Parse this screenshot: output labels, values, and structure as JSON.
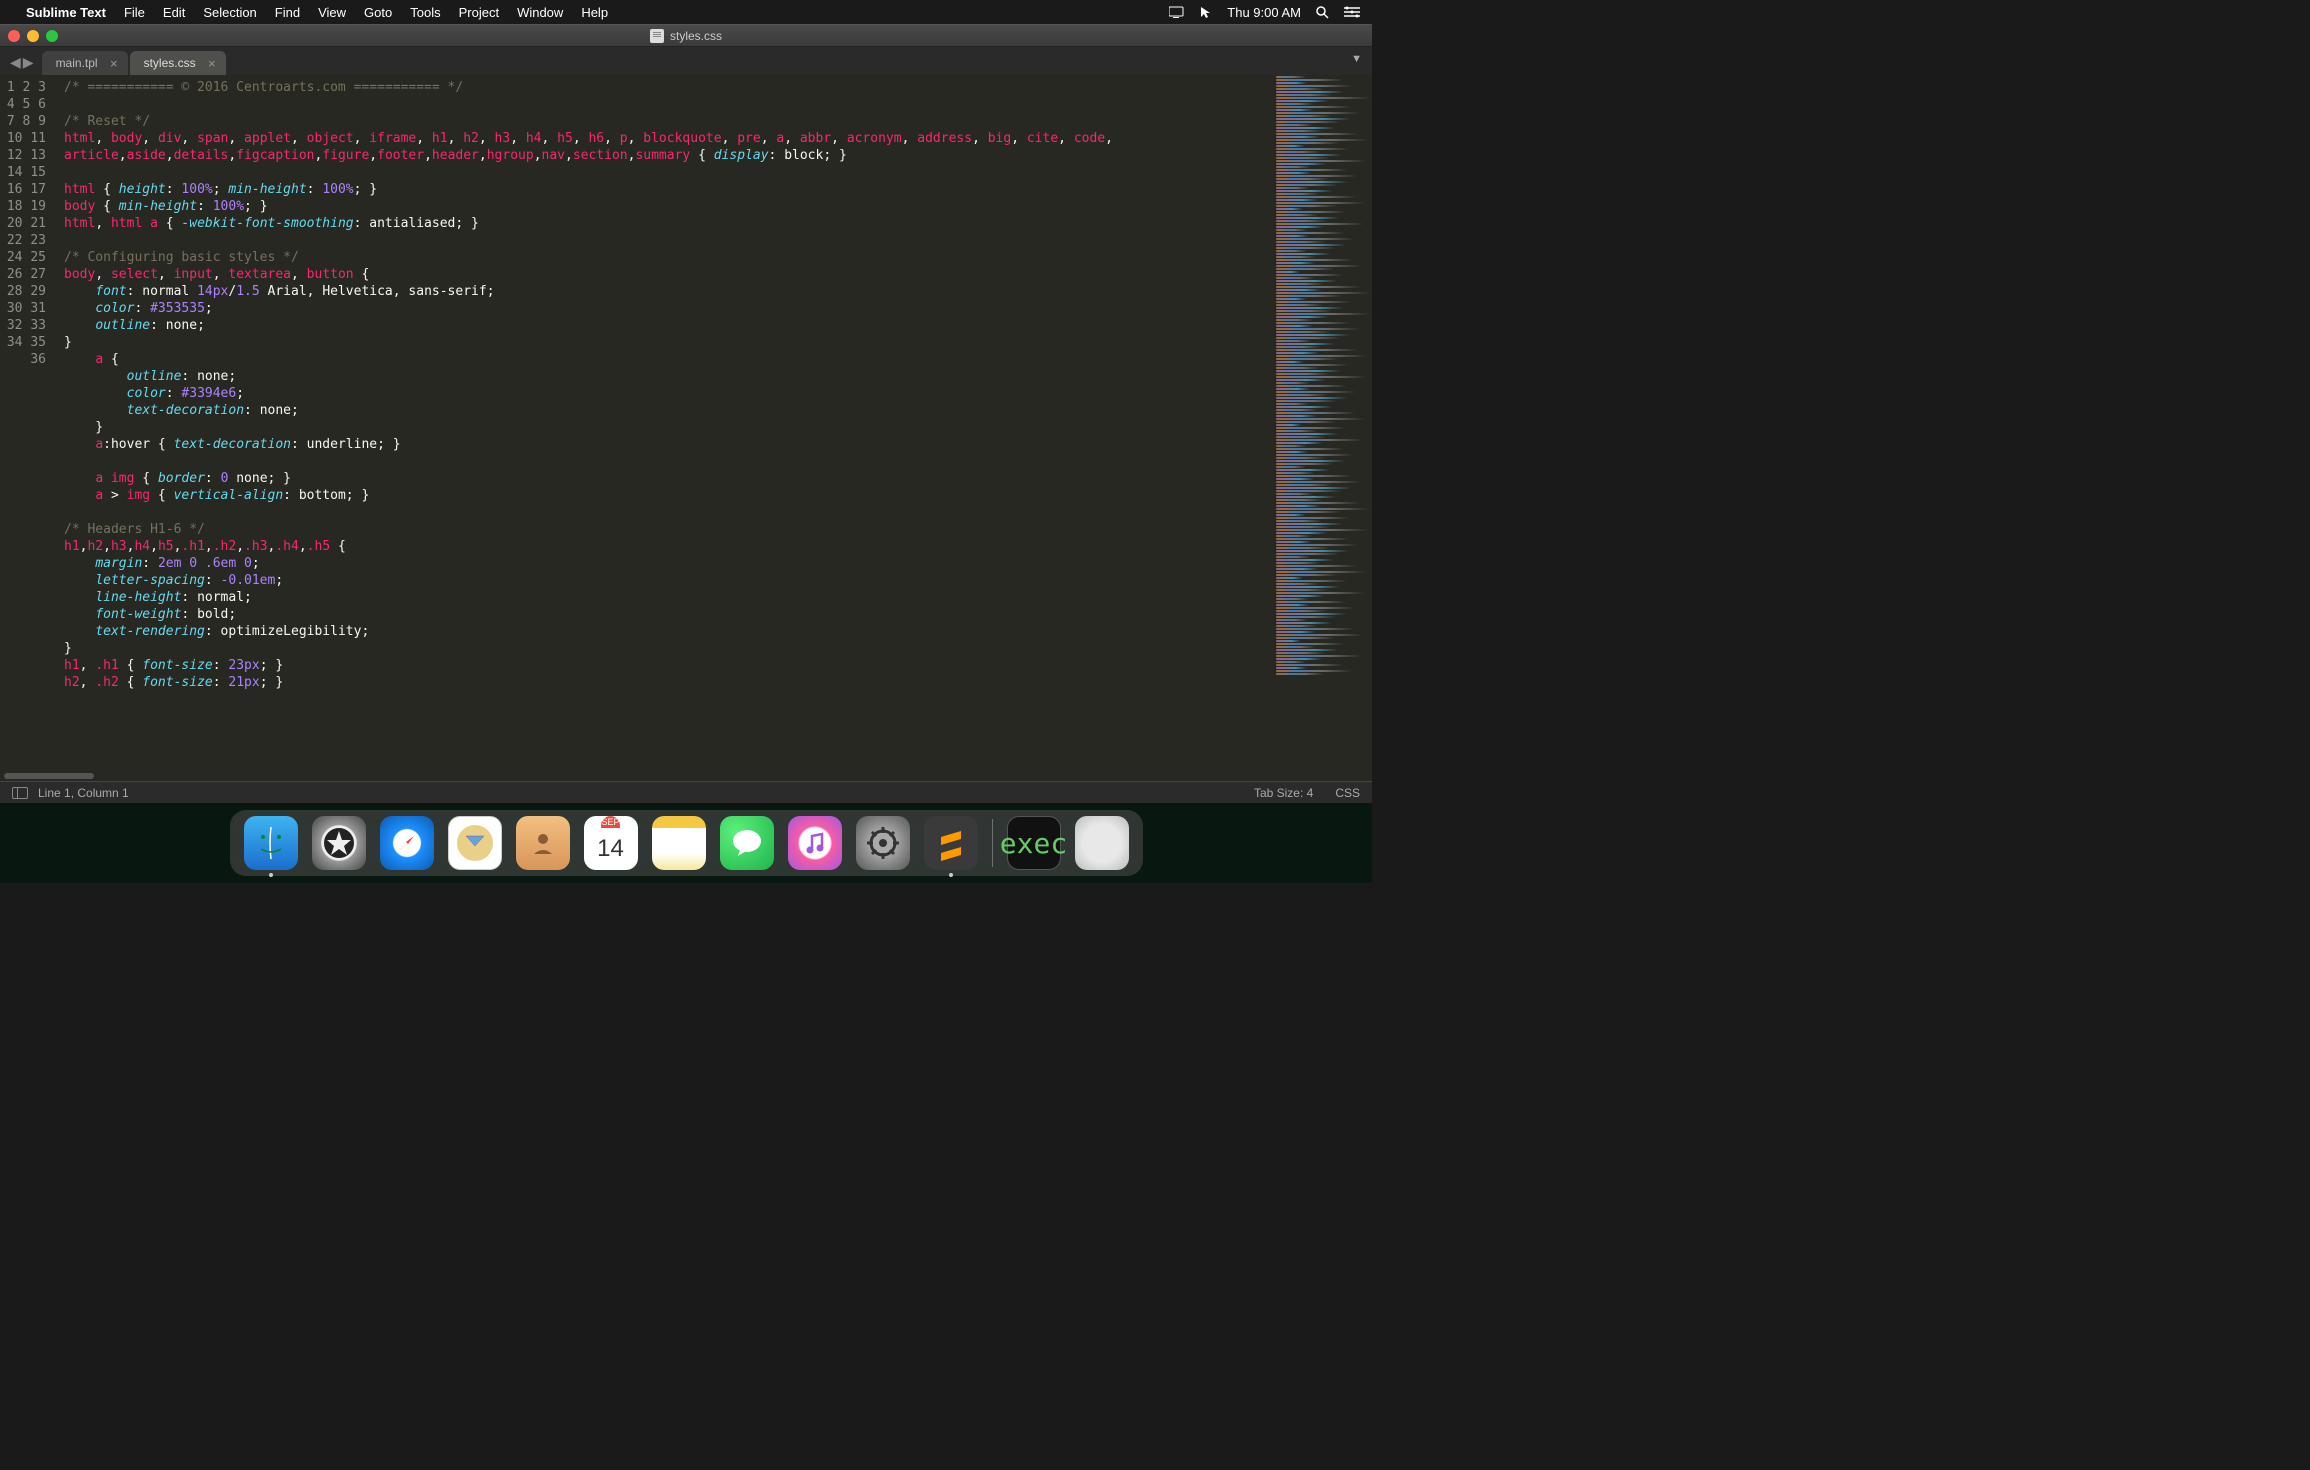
{
  "menubar": {
    "app_name": "Sublime Text",
    "items": [
      "File",
      "Edit",
      "Selection",
      "Find",
      "View",
      "Goto",
      "Tools",
      "Project",
      "Window",
      "Help"
    ],
    "right": {
      "time": "Thu 9:00 AM"
    }
  },
  "window": {
    "title": "styles.css"
  },
  "tabs": [
    {
      "label": "main.tpl",
      "active": false
    },
    {
      "label": "styles.css",
      "active": true
    }
  ],
  "gutter_start": 1,
  "gutter_end": 36,
  "code_lines": [
    [
      [
        "c-com",
        "/* =========== © 2016 Centroarts.com =========== */"
      ]
    ],
    [],
    [
      [
        "c-com",
        "/* Reset */"
      ]
    ],
    [
      [
        "c-tag",
        "html"
      ],
      [
        "c-punc",
        ", "
      ],
      [
        "c-tag",
        "body"
      ],
      [
        "c-punc",
        ", "
      ],
      [
        "c-tag",
        "div"
      ],
      [
        "c-punc",
        ", "
      ],
      [
        "c-tag",
        "span"
      ],
      [
        "c-punc",
        ", "
      ],
      [
        "c-tag",
        "applet"
      ],
      [
        "c-punc",
        ", "
      ],
      [
        "c-tag",
        "object"
      ],
      [
        "c-punc",
        ", "
      ],
      [
        "c-tag",
        "iframe"
      ],
      [
        "c-punc",
        ", "
      ],
      [
        "c-tag",
        "h1"
      ],
      [
        "c-punc",
        ", "
      ],
      [
        "c-tag",
        "h2"
      ],
      [
        "c-punc",
        ", "
      ],
      [
        "c-tag",
        "h3"
      ],
      [
        "c-punc",
        ", "
      ],
      [
        "c-tag",
        "h4"
      ],
      [
        "c-punc",
        ", "
      ],
      [
        "c-tag",
        "h5"
      ],
      [
        "c-punc",
        ", "
      ],
      [
        "c-tag",
        "h6"
      ],
      [
        "c-punc",
        ", "
      ],
      [
        "c-tag",
        "p"
      ],
      [
        "c-punc",
        ", "
      ],
      [
        "c-tag",
        "blockquote"
      ],
      [
        "c-punc",
        ", "
      ],
      [
        "c-tag",
        "pre"
      ],
      [
        "c-punc",
        ", "
      ],
      [
        "c-tag",
        "a"
      ],
      [
        "c-punc",
        ", "
      ],
      [
        "c-tag",
        "abbr"
      ],
      [
        "c-punc",
        ", "
      ],
      [
        "c-tag",
        "acronym"
      ],
      [
        "c-punc",
        ", "
      ],
      [
        "c-tag",
        "address"
      ],
      [
        "c-punc",
        ", "
      ],
      [
        "c-tag",
        "big"
      ],
      [
        "c-punc",
        ", "
      ],
      [
        "c-tag",
        "cite"
      ],
      [
        "c-punc",
        ", "
      ],
      [
        "c-tag",
        "code"
      ],
      [
        "c-punc",
        ", "
      ]
    ],
    [
      [
        "c-tag",
        "article"
      ],
      [
        "c-punc",
        ","
      ],
      [
        "c-tag",
        "aside"
      ],
      [
        "c-punc",
        ","
      ],
      [
        "c-tag",
        "details"
      ],
      [
        "c-punc",
        ","
      ],
      [
        "c-tag",
        "figcaption"
      ],
      [
        "c-punc",
        ","
      ],
      [
        "c-tag",
        "figure"
      ],
      [
        "c-punc",
        ","
      ],
      [
        "c-tag",
        "footer"
      ],
      [
        "c-punc",
        ","
      ],
      [
        "c-tag",
        "header"
      ],
      [
        "c-punc",
        ","
      ],
      [
        "c-tag",
        "hgroup"
      ],
      [
        "c-punc",
        ","
      ],
      [
        "c-tag",
        "nav"
      ],
      [
        "c-punc",
        ","
      ],
      [
        "c-tag",
        "section"
      ],
      [
        "c-punc",
        ","
      ],
      [
        "c-tag",
        "summary"
      ],
      [
        "c-punc",
        " { "
      ],
      [
        "c-prop",
        "display"
      ],
      [
        "c-punc",
        ": "
      ],
      [
        "c-val",
        "block"
      ],
      [
        "c-punc",
        "; }"
      ]
    ],
    [],
    [
      [
        "c-tag",
        "html"
      ],
      [
        "c-punc",
        " { "
      ],
      [
        "c-prop",
        "height"
      ],
      [
        "c-punc",
        ": "
      ],
      [
        "c-num",
        "100%"
      ],
      [
        "c-punc",
        "; "
      ],
      [
        "c-prop",
        "min-height"
      ],
      [
        "c-punc",
        ": "
      ],
      [
        "c-num",
        "100%"
      ],
      [
        "c-punc",
        "; }"
      ]
    ],
    [
      [
        "c-tag",
        "body"
      ],
      [
        "c-punc",
        " { "
      ],
      [
        "c-prop",
        "min-height"
      ],
      [
        "c-punc",
        ": "
      ],
      [
        "c-num",
        "100%"
      ],
      [
        "c-punc",
        "; }"
      ]
    ],
    [
      [
        "c-tag",
        "html"
      ],
      [
        "c-punc",
        ", "
      ],
      [
        "c-tag",
        "html a"
      ],
      [
        "c-punc",
        " { "
      ],
      [
        "c-prop",
        "-webkit-font-smoothing"
      ],
      [
        "c-punc",
        ": "
      ],
      [
        "c-val",
        "antialiased"
      ],
      [
        "c-punc",
        "; }"
      ]
    ],
    [],
    [
      [
        "c-com",
        "/* Configuring basic styles */"
      ]
    ],
    [
      [
        "c-tag",
        "body"
      ],
      [
        "c-punc",
        ", "
      ],
      [
        "c-tag",
        "select"
      ],
      [
        "c-punc",
        ", "
      ],
      [
        "c-tag",
        "input"
      ],
      [
        "c-punc",
        ", "
      ],
      [
        "c-tag",
        "textarea"
      ],
      [
        "c-punc",
        ", "
      ],
      [
        "c-tag",
        "button"
      ],
      [
        "c-punc",
        " {"
      ]
    ],
    [
      [
        "c-punc",
        "    "
      ],
      [
        "c-prop",
        "font"
      ],
      [
        "c-punc",
        ": "
      ],
      [
        "c-val",
        "normal "
      ],
      [
        "c-num",
        "14px"
      ],
      [
        "c-val",
        "/"
      ],
      [
        "c-num",
        "1.5"
      ],
      [
        "c-val",
        " Arial, Helvetica, sans-serif"
      ],
      [
        "c-punc",
        ";"
      ]
    ],
    [
      [
        "c-punc",
        "    "
      ],
      [
        "c-prop",
        "color"
      ],
      [
        "c-punc",
        ": "
      ],
      [
        "c-num",
        "#353535"
      ],
      [
        "c-punc",
        ";"
      ]
    ],
    [
      [
        "c-punc",
        "    "
      ],
      [
        "c-prop",
        "outline"
      ],
      [
        "c-punc",
        ": "
      ],
      [
        "c-val",
        "none"
      ],
      [
        "c-punc",
        ";"
      ]
    ],
    [
      [
        "c-punc",
        "}"
      ]
    ],
    [
      [
        "c-punc",
        "    "
      ],
      [
        "c-tag",
        "a"
      ],
      [
        "c-punc",
        " {"
      ]
    ],
    [
      [
        "c-punc",
        "        "
      ],
      [
        "c-prop",
        "outline"
      ],
      [
        "c-punc",
        ": "
      ],
      [
        "c-val",
        "none"
      ],
      [
        "c-punc",
        ";"
      ]
    ],
    [
      [
        "c-punc",
        "        "
      ],
      [
        "c-prop",
        "color"
      ],
      [
        "c-punc",
        ": "
      ],
      [
        "c-num",
        "#3394e6"
      ],
      [
        "c-punc",
        ";"
      ]
    ],
    [
      [
        "c-punc",
        "        "
      ],
      [
        "c-prop",
        "text-decoration"
      ],
      [
        "c-punc",
        ": "
      ],
      [
        "c-val",
        "none"
      ],
      [
        "c-punc",
        ";"
      ]
    ],
    [
      [
        "c-punc",
        "    }"
      ]
    ],
    [
      [
        "c-punc",
        "    "
      ],
      [
        "c-tag",
        "a"
      ],
      [
        "c-punc",
        ":hover { "
      ],
      [
        "c-prop",
        "text-decoration"
      ],
      [
        "c-punc",
        ": "
      ],
      [
        "c-val",
        "underline"
      ],
      [
        "c-punc",
        "; }"
      ]
    ],
    [],
    [
      [
        "c-punc",
        "    "
      ],
      [
        "c-tag",
        "a img"
      ],
      [
        "c-punc",
        " { "
      ],
      [
        "c-prop",
        "border"
      ],
      [
        "c-punc",
        ": "
      ],
      [
        "c-num",
        "0"
      ],
      [
        "c-val",
        " none"
      ],
      [
        "c-punc",
        "; }"
      ]
    ],
    [
      [
        "c-punc",
        "    "
      ],
      [
        "c-tag",
        "a"
      ],
      [
        "c-punc",
        " > "
      ],
      [
        "c-tag",
        "img"
      ],
      [
        "c-punc",
        " { "
      ],
      [
        "c-prop",
        "vertical-align"
      ],
      [
        "c-punc",
        ": "
      ],
      [
        "c-val",
        "bottom"
      ],
      [
        "c-punc",
        "; }"
      ]
    ],
    [],
    [
      [
        "c-com",
        "/* Headers H1-6 */"
      ]
    ],
    [
      [
        "c-tag",
        "h1"
      ],
      [
        "c-punc",
        ","
      ],
      [
        "c-tag",
        "h2"
      ],
      [
        "c-punc",
        ","
      ],
      [
        "c-tag",
        "h3"
      ],
      [
        "c-punc",
        ","
      ],
      [
        "c-tag",
        "h4"
      ],
      [
        "c-punc",
        ","
      ],
      [
        "c-tag",
        "h5"
      ],
      [
        "c-punc",
        ","
      ],
      [
        "c-tag",
        ".h1"
      ],
      [
        "c-punc",
        ","
      ],
      [
        "c-tag",
        ".h2"
      ],
      [
        "c-punc",
        ","
      ],
      [
        "c-tag",
        ".h3"
      ],
      [
        "c-punc",
        ","
      ],
      [
        "c-tag",
        ".h4"
      ],
      [
        "c-punc",
        ","
      ],
      [
        "c-tag",
        ".h5"
      ],
      [
        "c-punc",
        " {"
      ]
    ],
    [
      [
        "c-punc",
        "    "
      ],
      [
        "c-prop",
        "margin"
      ],
      [
        "c-punc",
        ": "
      ],
      [
        "c-num",
        "2em 0 .6em 0"
      ],
      [
        "c-punc",
        ";"
      ]
    ],
    [
      [
        "c-punc",
        "    "
      ],
      [
        "c-prop",
        "letter-spacing"
      ],
      [
        "c-punc",
        ": "
      ],
      [
        "c-num",
        "-0.01em"
      ],
      [
        "c-punc",
        ";"
      ]
    ],
    [
      [
        "c-punc",
        "    "
      ],
      [
        "c-prop",
        "line-height"
      ],
      [
        "c-punc",
        ": "
      ],
      [
        "c-val",
        "normal"
      ],
      [
        "c-punc",
        ";"
      ]
    ],
    [
      [
        "c-punc",
        "    "
      ],
      [
        "c-prop",
        "font-weight"
      ],
      [
        "c-punc",
        ": "
      ],
      [
        "c-val",
        "bold"
      ],
      [
        "c-punc",
        ";"
      ]
    ],
    [
      [
        "c-punc",
        "    "
      ],
      [
        "c-prop",
        "text-rendering"
      ],
      [
        "c-punc",
        ": "
      ],
      [
        "c-val",
        "optimizeLegibility"
      ],
      [
        "c-punc",
        ";"
      ]
    ],
    [
      [
        "c-punc",
        "}"
      ]
    ],
    [
      [
        "c-tag",
        "h1"
      ],
      [
        "c-punc",
        ", "
      ],
      [
        "c-tag",
        ".h1"
      ],
      [
        "c-punc",
        " { "
      ],
      [
        "c-prop",
        "font-size"
      ],
      [
        "c-punc",
        ": "
      ],
      [
        "c-num",
        "23px"
      ],
      [
        "c-punc",
        "; }"
      ]
    ],
    [
      [
        "c-tag",
        "h2"
      ],
      [
        "c-punc",
        ", "
      ],
      [
        "c-tag",
        ".h2"
      ],
      [
        "c-punc",
        " { "
      ],
      [
        "c-prop",
        "font-size"
      ],
      [
        "c-punc",
        ": "
      ],
      [
        "c-num",
        "21px"
      ],
      [
        "c-punc",
        "; }"
      ]
    ]
  ],
  "statusbar": {
    "position": "Line 1, Column 1",
    "tabsize": "Tab Size: 4",
    "syntax": "CSS"
  },
  "dock": {
    "calendar": {
      "month": "SEP",
      "day": "14"
    },
    "term_label": "exec",
    "items": [
      "finder",
      "launchpad",
      "safari",
      "mail",
      "contacts",
      "calendar",
      "notes",
      "messages",
      "itunes",
      "settings",
      "sublime"
    ],
    "right_items": [
      "terminal",
      "trash"
    ],
    "running": [
      "finder",
      "sublime"
    ]
  }
}
